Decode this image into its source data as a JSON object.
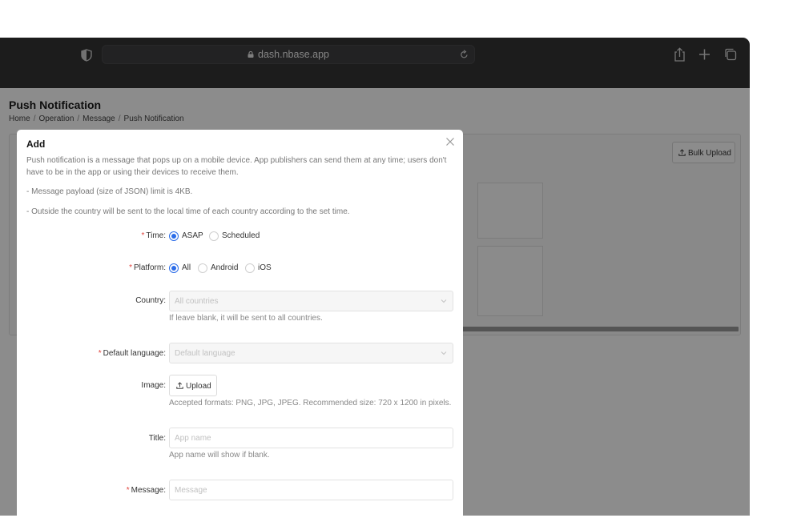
{
  "browser": {
    "url": "dash.nbase.app"
  },
  "page": {
    "title": "Push Notification",
    "breadcrumb": [
      "Home",
      "Operation",
      "Message",
      "Push Notification"
    ],
    "bulk_upload_label": "Bulk Upload"
  },
  "modal": {
    "title": "Add",
    "description": "Push notification is a message that pops up on a mobile device. App publishers can send them at any time; users don't have to be in the app or using their devices to receive them.",
    "note_payload": "- Message payload (size of JSON) limit is 4KB.",
    "note_country": "- Outside the country will be sent to the local time of each country according to the set time.",
    "time": {
      "label": "Time:",
      "options": [
        "ASAP",
        "Scheduled"
      ],
      "selected": "ASAP"
    },
    "platform": {
      "label": "Platform:",
      "options": [
        "All",
        "Android",
        "iOS"
      ],
      "selected": "All"
    },
    "country": {
      "label": "Country:",
      "placeholder": "All countries",
      "hint": "If leave blank, it will be sent to all countries."
    },
    "default_language": {
      "label": "Default language:",
      "placeholder": "Default language"
    },
    "image": {
      "label": "Image:",
      "button": "Upload",
      "hint": "Accepted formats: PNG, JPG, JPEG. Recommended size: 720 x 1200 in pixels."
    },
    "title_field": {
      "label": "Title:",
      "placeholder": "App name",
      "hint": "App name will show if blank."
    },
    "message": {
      "label": "Message:",
      "placeholder": "Message"
    }
  },
  "colors": {
    "accent": "#2b6ce8",
    "required": "#e0423c",
    "toolbar": "#343434"
  }
}
